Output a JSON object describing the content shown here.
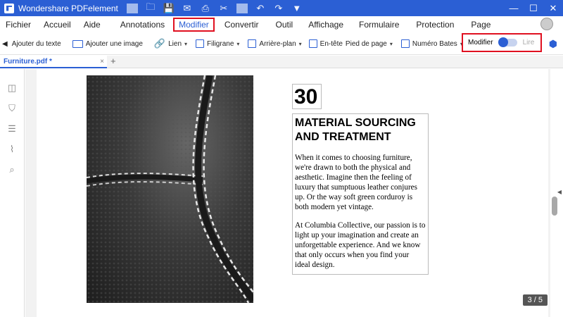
{
  "titlebar": {
    "app_name": "Wondershare PDFelement"
  },
  "window_controls": {
    "minimize": "—",
    "maximize": "☐",
    "close": "✕"
  },
  "menu": [
    "Fichier",
    "Accueil",
    "Aide",
    "Annotations",
    "Modifier",
    "Convertir",
    "Outil",
    "Affichage",
    "Formulaire",
    "Protection",
    "Page"
  ],
  "menu_active": "Modifier",
  "toolbar": {
    "add_text": "Ajouter du texte",
    "add_image": "Ajouter une image",
    "link": "Lien",
    "watermark": "Filigrane",
    "background": "Arrière-plan",
    "header": "En-tête",
    "footer": "Pied de page",
    "bates": "Numéro Bates"
  },
  "mode": {
    "edit": "Modifier",
    "read": "Lire"
  },
  "tab": {
    "filename": "Furniture.pdf *",
    "close": "×",
    "add": "+"
  },
  "document": {
    "number": "30",
    "heading": "MATERIAL SOURCING AND TREATMENT",
    "para1": "When it comes to choosing furniture, we're drawn to both the physical and aesthetic. Imagine then the feeling of luxury that sumptuous leather conjures up. Or the way soft green corduroy is both modern yet vintage.",
    "para2": "At Columbia Collective, our passion is to light up your imagination and create an unforgettable experience. And we know that only occurs when you find your ideal design."
  },
  "page_indicator": "3 / 5",
  "colors": {
    "accent": "#2b5fd4",
    "highlight": "#e01020"
  }
}
